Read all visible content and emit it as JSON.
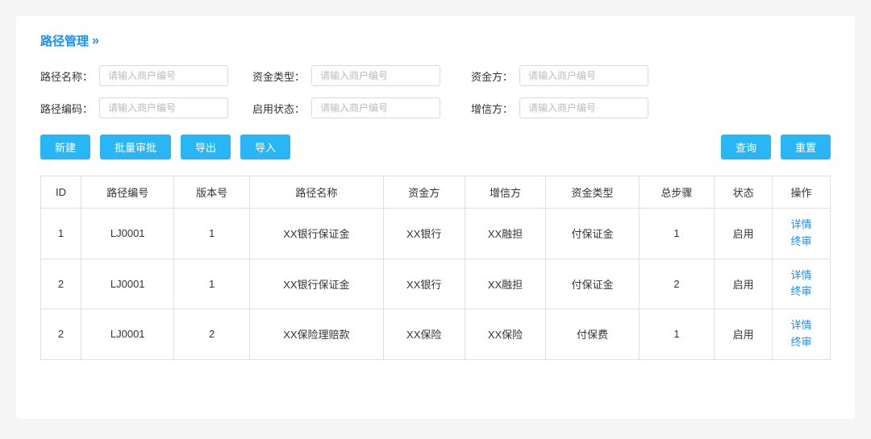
{
  "page": {
    "title": "路径管理",
    "chevron": "»"
  },
  "form": {
    "row1": [
      {
        "label": "路径名称：",
        "placeholder": "请输入商户编号",
        "name": "path-name-input"
      },
      {
        "label": "资金类型：",
        "placeholder": "请输入商户编号",
        "name": "fund-type-input"
      },
      {
        "label": "资金方：",
        "placeholder": "请输入商户编号",
        "name": "fund-party-input"
      }
    ],
    "row2": [
      {
        "label": "路径编码：",
        "placeholder": "请输入商户编号",
        "name": "path-code-input"
      },
      {
        "label": "启用状态：",
        "placeholder": "请输入商户编号",
        "name": "status-input"
      },
      {
        "label": "增信方：",
        "placeholder": "请输入商户编号",
        "name": "credit-party-input"
      }
    ]
  },
  "toolbar": {
    "buttons": [
      {
        "label": "新建",
        "name": "create-button"
      },
      {
        "label": "批量审批",
        "name": "batch-approve-button"
      },
      {
        "label": "导出",
        "name": "export-button"
      },
      {
        "label": "导入",
        "name": "import-button"
      },
      {
        "label": "查询",
        "name": "search-button"
      },
      {
        "label": "重置",
        "name": "reset-button"
      }
    ]
  },
  "table": {
    "columns": [
      "ID",
      "路径编号",
      "版本号",
      "路径名称",
      "资金方",
      "增信方",
      "资金类型",
      "总步骤",
      "状态",
      "操作"
    ],
    "rows": [
      {
        "id": "1",
        "path_code": "LJ0001",
        "version": "1",
        "path_name": "XX银行保证金",
        "fund_party": "XX银行",
        "credit_party": "XX融担",
        "fund_type": "付保证金",
        "total_steps": "1",
        "status": "启用",
        "action1": "详情",
        "action2": "终审"
      },
      {
        "id": "2",
        "path_code": "LJ0001",
        "version": "1",
        "path_name": "XX银行保证金",
        "fund_party": "XX银行",
        "credit_party": "XX融担",
        "fund_type": "付保证金",
        "total_steps": "2",
        "status": "启用",
        "action1": "详情",
        "action2": "终审"
      },
      {
        "id": "2",
        "path_code": "LJ0001",
        "version": "2",
        "path_name": "XX保险理赔款",
        "fund_party": "XX保险",
        "credit_party": "XX保险",
        "fund_type": "付保费",
        "total_steps": "1",
        "status": "启用",
        "action1": "详情",
        "action2": "终审"
      }
    ]
  }
}
